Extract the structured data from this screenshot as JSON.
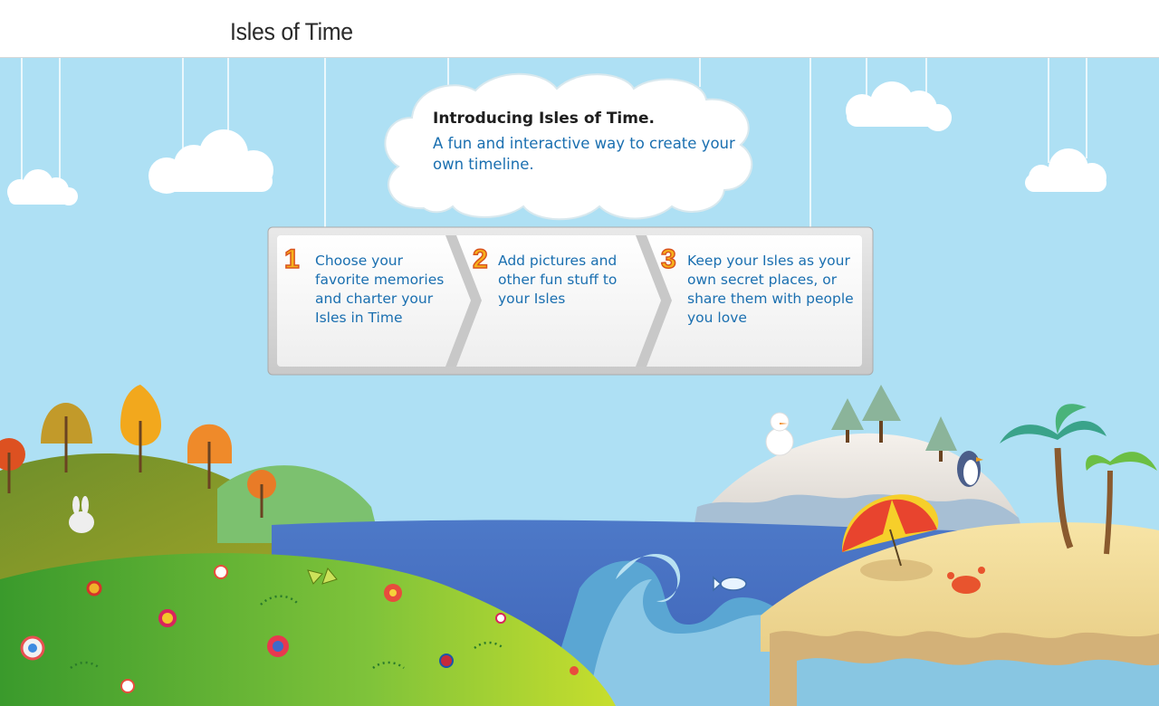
{
  "header": {
    "title": "Isles of Time"
  },
  "intro": {
    "title": "Introducing Isles of Time.",
    "subtitle": "A fun and interactive way to create your own timeline."
  },
  "steps": [
    {
      "number": "1",
      "text": "Choose your favorite memories and charter your Isles in Time"
    },
    {
      "number": "2",
      "text": "Add pictures and other fun stuff to your Isles"
    },
    {
      "number": "3",
      "text": "Keep your Isles as your own secret places, or share them with people you love"
    }
  ],
  "colors": {
    "sky": "#aee0f4",
    "cloud": "#ffffff",
    "sea": "#4a86cf",
    "grass_light": "#8ccc3c",
    "step_text": "#1a6fb0",
    "step_number": "#f7b21a"
  }
}
